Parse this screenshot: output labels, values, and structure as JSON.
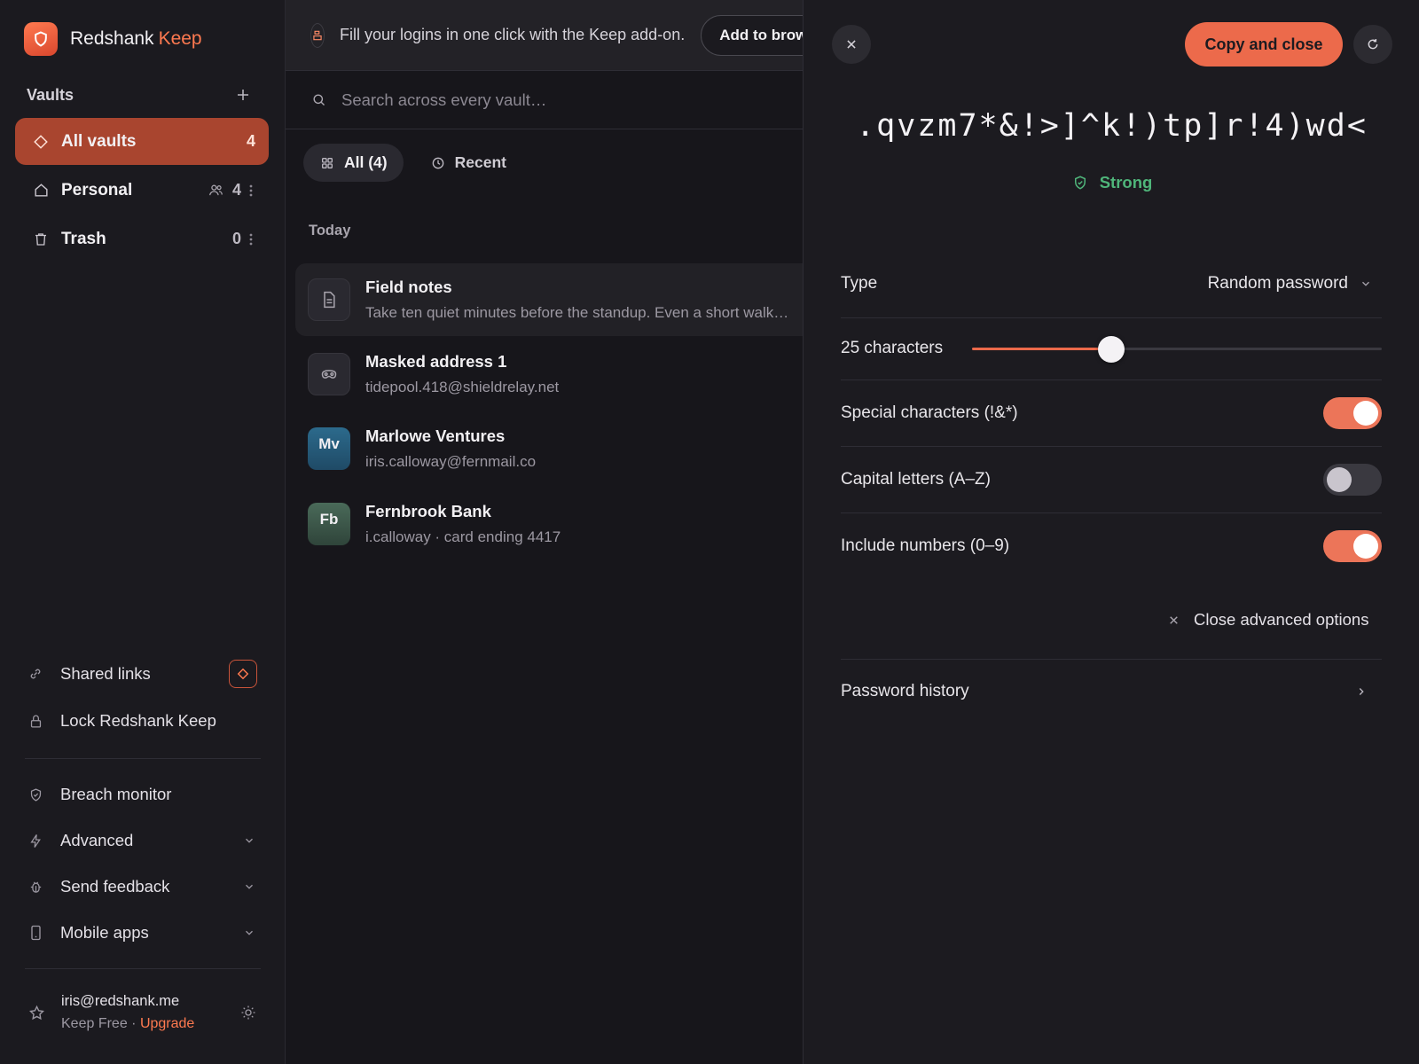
{
  "brand": {
    "name": "Redshank",
    "accent": "Keep",
    "logo_icon": "shield-icon"
  },
  "sidebar": {
    "vaults_label": "Vaults",
    "vaults": [
      {
        "label": "All vaults",
        "count": "4",
        "icon": "diamond-icon",
        "active": true
      },
      {
        "label": "Personal",
        "count": "4",
        "icon": "home-icon",
        "shared": true
      },
      {
        "label": "Trash",
        "count": "0",
        "icon": "trash-icon"
      }
    ],
    "links": [
      {
        "label": "Shared links",
        "icon": "link-icon"
      },
      {
        "label": "Lock Redshank Keep",
        "icon": "lock-icon"
      }
    ],
    "tools": [
      {
        "label": "Breach monitor",
        "icon": "shield-icon"
      },
      {
        "label": "Advanced",
        "icon": "bolt-icon"
      },
      {
        "label": "Send feedback",
        "icon": "bug-icon"
      },
      {
        "label": "Mobile apps",
        "icon": "phone-icon"
      }
    ],
    "user": {
      "email": "iris@redshank.me",
      "plan": "Keep Free",
      "separator": "·",
      "upgrade": "Upgrade"
    }
  },
  "list": {
    "banner": {
      "text": "Fill your logins in one click with the Keep add-on.",
      "button": "Add to browser"
    },
    "search": {
      "placeholder": "Search across every vault…"
    },
    "filters": {
      "all": "All (4)",
      "recent": "Recent"
    },
    "group": "Today",
    "items": [
      {
        "title": "Field notes",
        "subtitle": "Take ten quiet minutes before the standup. Even a short walk…",
        "icon": "note-icon"
      },
      {
        "title": "Masked address 1",
        "subtitle": "tidepool.418@shieldrelay.net",
        "icon": "mask-icon"
      },
      {
        "title": "Marlowe Ventures",
        "subtitle": "iris.calloway@fernmail.co",
        "initials": "Mv"
      },
      {
        "title": "Fernbrook Bank",
        "subtitle": "i.calloway · card ending 4417",
        "initials": "Fb"
      }
    ]
  },
  "generator": {
    "copy_button": "Copy and close",
    "password": ".qvzm7*&!>]^k!)tp]r!4)wd<",
    "strength": "Strong",
    "type_label": "Type",
    "type_value": "Random password",
    "length_label": "25 characters",
    "length_fraction": 0.34,
    "options": [
      {
        "label": "Special characters (!&*)",
        "on": true
      },
      {
        "label": "Capital letters (A–Z)",
        "on": false
      },
      {
        "label": "Include numbers (0–9)",
        "on": true
      }
    ],
    "close_advanced": "Close advanced options",
    "history": "Password history"
  },
  "colors": {
    "accent": "#ec6a4b",
    "active_vault": "#a9452f",
    "strong": "#4fb57a"
  }
}
